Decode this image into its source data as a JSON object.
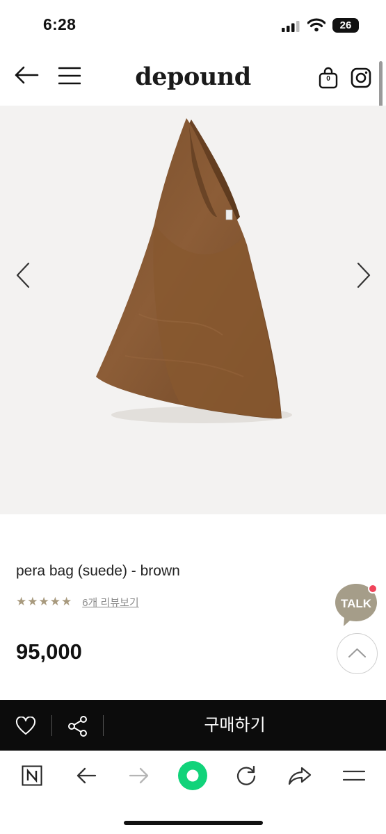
{
  "status_bar": {
    "time": "6:28",
    "battery": "26"
  },
  "header": {
    "logo": "depound",
    "cart_count": "0",
    "icons": [
      "back-arrow-icon",
      "menu-icon",
      "shopping-bag-icon",
      "instagram-icon"
    ]
  },
  "product": {
    "name": "pera bag (suede) - brown",
    "rating_stars": "★★★★★",
    "review_link": "6개 리뷰보기",
    "price": "95,000"
  },
  "floating": {
    "talk_label": "TALK"
  },
  "buy_bar": {
    "buy_label": "구매하기"
  },
  "browser_bar": {
    "icons": [
      "naver-n-icon",
      "back-icon",
      "forward-icon",
      "green-home-icon",
      "refresh-icon",
      "share-icon",
      "menu-icon"
    ]
  },
  "colors": {
    "buy_bar_bg": "#0c0c0c",
    "star_color": "#a89a7e",
    "talk_bg": "#a59d89",
    "talk_notification": "#f0445a",
    "browser_green": "#11d37a",
    "bag_brown": "#8a5a34"
  }
}
